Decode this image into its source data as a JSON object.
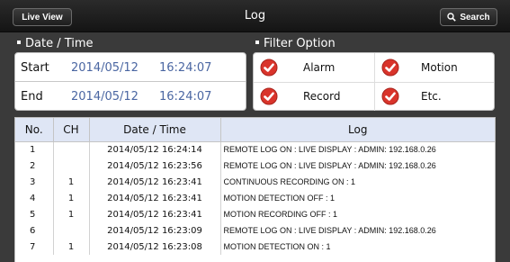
{
  "header": {
    "live_view_label": "Live View",
    "title": "Log",
    "search_label": "Search"
  },
  "date_time": {
    "section_label": "Date / Time",
    "start": {
      "label": "Start",
      "date": "2014/05/12",
      "time": "16:24:07"
    },
    "end": {
      "label": "End",
      "date": "2014/05/12",
      "time": "16:24:07"
    }
  },
  "filter": {
    "section_label": "Filter Option",
    "options": [
      {
        "label": "Alarm",
        "checked": true
      },
      {
        "label": "Motion",
        "checked": true
      },
      {
        "label": "Record",
        "checked": true
      },
      {
        "label": "Etc.",
        "checked": true
      }
    ]
  },
  "table": {
    "columns": [
      "No.",
      "CH",
      "Date / Time",
      "Log"
    ],
    "rows": [
      {
        "no": "1",
        "ch": "",
        "datetime": "2014/05/12 16:24:14",
        "log": "REMOTE LOG ON : LIVE DISPLAY : ADMIN: 192.168.0.26"
      },
      {
        "no": "2",
        "ch": "",
        "datetime": "2014/05/12 16:23:56",
        "log": "REMOTE LOG ON : LIVE DISPLAY : ADMIN: 192.168.0.26"
      },
      {
        "no": "3",
        "ch": "1",
        "datetime": "2014/05/12 16:23:41",
        "log": "CONTINUOUS RECORDING ON : 1"
      },
      {
        "no": "4",
        "ch": "1",
        "datetime": "2014/05/12 16:23:41",
        "log": "MOTION DETECTION OFF : 1"
      },
      {
        "no": "5",
        "ch": "1",
        "datetime": "2014/05/12 16:23:41",
        "log": "MOTION RECORDING OFF : 1"
      },
      {
        "no": "6",
        "ch": "",
        "datetime": "2014/05/12 16:23:09",
        "log": "REMOTE LOG ON : LIVE DISPLAY : ADMIN: 192.168.0.26"
      },
      {
        "no": "7",
        "ch": "1",
        "datetime": "2014/05/12 16:23:08",
        "log": "MOTION DETECTION ON : 1"
      }
    ]
  },
  "colors": {
    "check_red": "#d9342b",
    "header_blue": "#dfe6f5",
    "date_blue": "#4a66a2"
  }
}
